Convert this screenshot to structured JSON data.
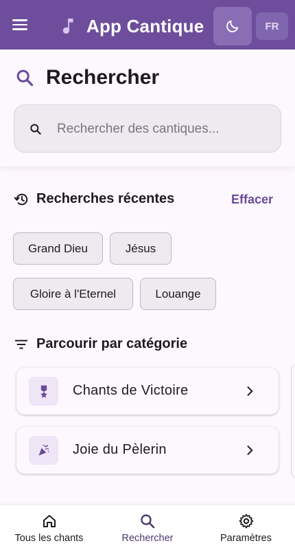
{
  "appbar": {
    "title": "App Cantique",
    "lang": "FR",
    "colors": {
      "bar": "#6E4E9C",
      "accent": "#6B4A98"
    },
    "icons": [
      "menu-icon",
      "music-note-icon",
      "moon-icon"
    ]
  },
  "search": {
    "title": "Rechercher",
    "placeholder": "Rechercher des cantiques...",
    "value": ""
  },
  "recent": {
    "title": "Recherches récentes",
    "clear": "Effacer",
    "items": [
      "Grand Dieu",
      "Jésus",
      "Gloire à l'Eternel",
      "Louange"
    ]
  },
  "categories": {
    "title": "Parcourir par catégorie",
    "items": [
      {
        "label": "Chants de Victoire",
        "icon": "medal-icon"
      },
      {
        "label": "Joie du Pèlerin",
        "icon": "celebration-icon"
      }
    ]
  },
  "nav": {
    "items": [
      {
        "label": "Tous les chants",
        "icon": "home-icon",
        "active": false
      },
      {
        "label": "Rechercher",
        "icon": "search-icon",
        "active": true
      },
      {
        "label": "Paramètres",
        "icon": "gear-icon",
        "active": false
      }
    ]
  }
}
